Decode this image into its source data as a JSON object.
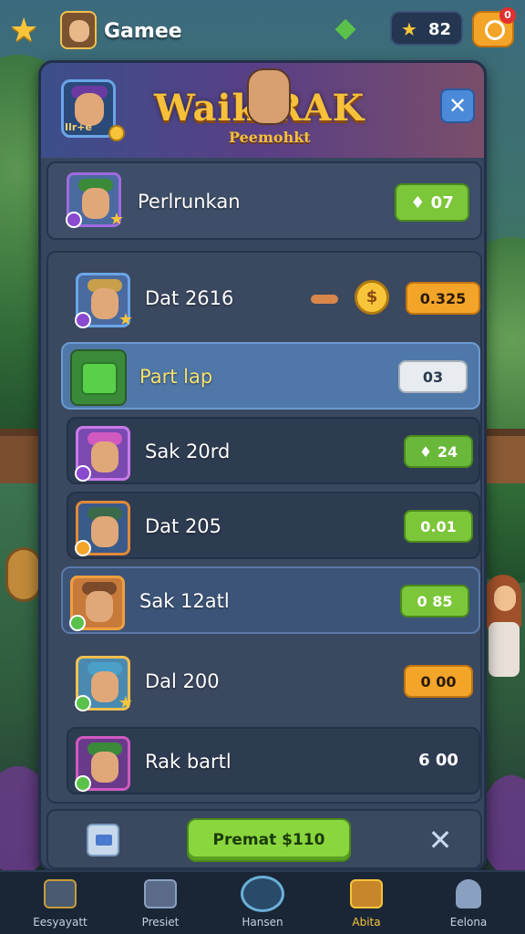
{
  "top_bar": {
    "title": "Gamee",
    "coins": "82"
  },
  "banner": {
    "title": "Waik RAK",
    "subtitle": "Peemohkt",
    "hero_tag": "Ilr+e"
  },
  "featured": {
    "label": "Perlrunkan",
    "price": "07"
  },
  "rows": [
    {
      "label": "Dat 2616",
      "price": "0.325",
      "style": "orange",
      "coin_glyph": "$"
    },
    {
      "label": "Part lap",
      "price": "03",
      "style": "white"
    },
    {
      "label": "Sak 20rd",
      "price": "24",
      "style": "green"
    },
    {
      "label": "Dat 205",
      "price": "0.01",
      "style": "green"
    },
    {
      "label": "Sak 12atl",
      "price": "0 85",
      "style": "green"
    },
    {
      "label": "Dal 200",
      "price": "0 00",
      "style": "orange"
    },
    {
      "label": "Rak bartl",
      "price": "6 00",
      "style": "plain"
    }
  ],
  "bottom": {
    "premium_label": "Premat $110"
  },
  "nav": [
    {
      "label": "Eesyayatt"
    },
    {
      "label": "Presiet"
    },
    {
      "label": "Hansen"
    },
    {
      "label": "Abita"
    },
    {
      "label": "Eelona"
    }
  ],
  "colors": {
    "accent_gold": "#f8c53a",
    "button_green": "#7cc63a",
    "button_orange": "#f3a52a",
    "panel_bg": "#36465e"
  }
}
